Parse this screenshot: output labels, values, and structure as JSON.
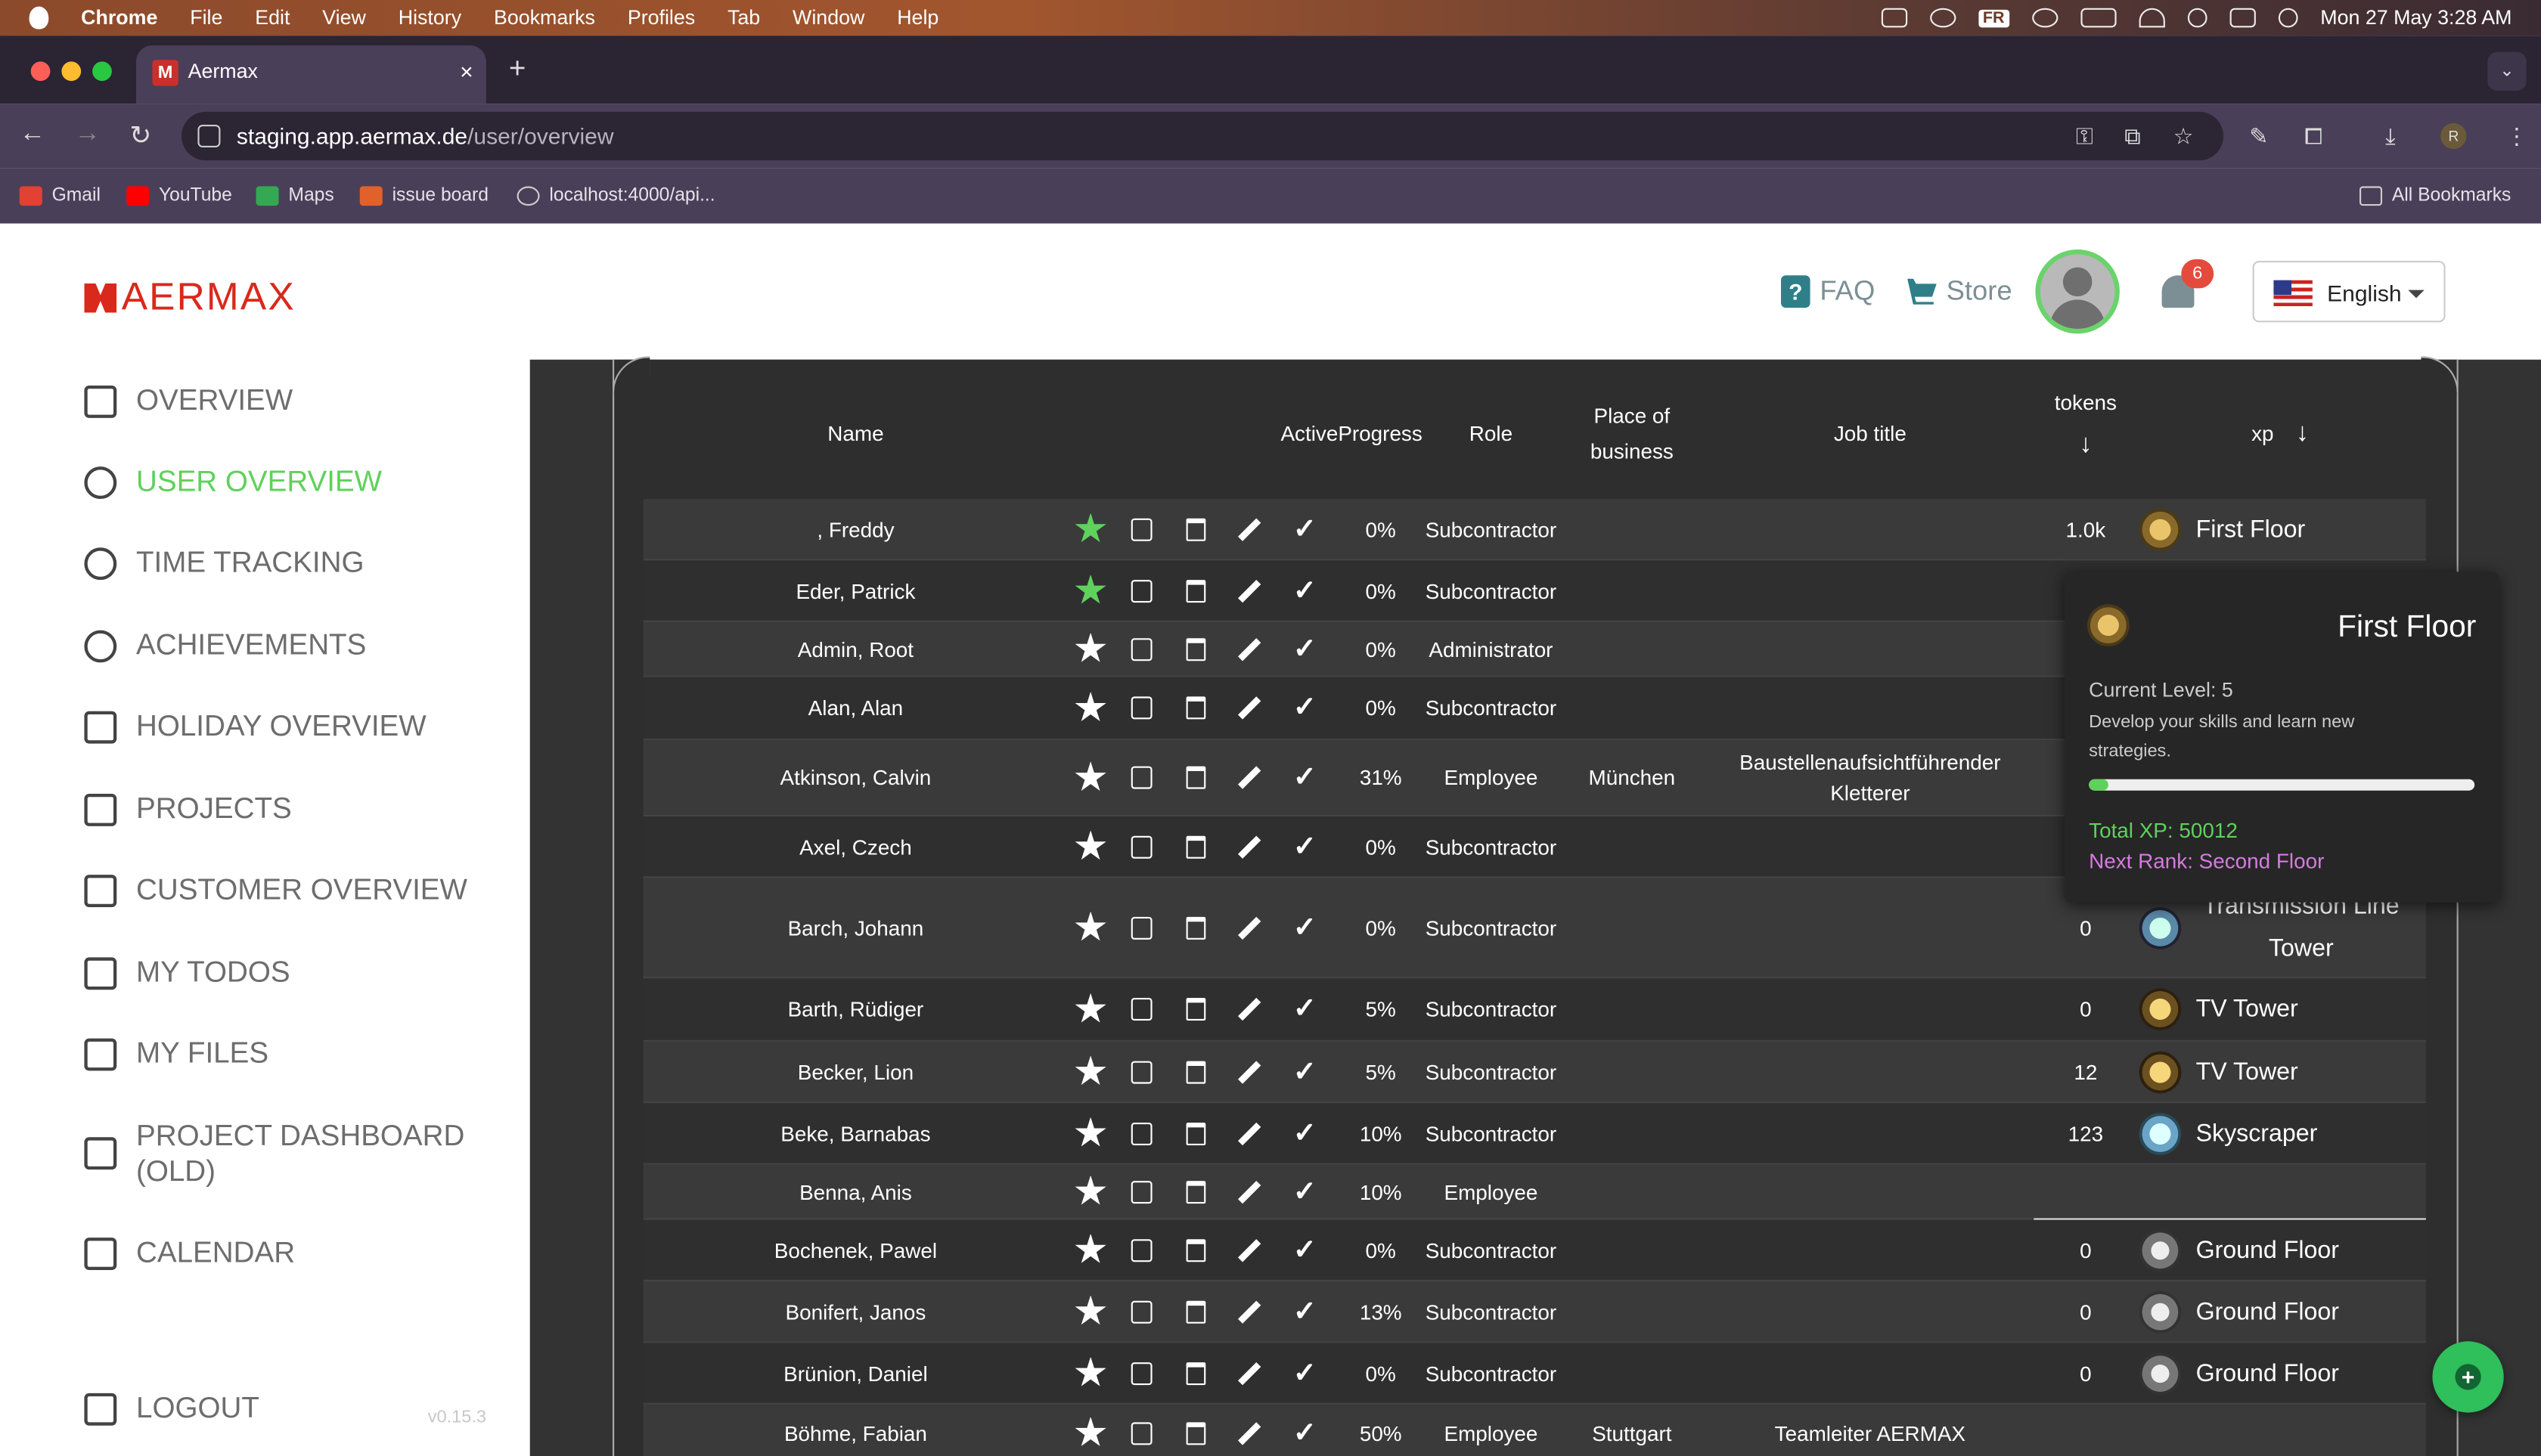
{
  "menubar": {
    "app": "Chrome",
    "items": [
      "File",
      "Edit",
      "View",
      "History",
      "Bookmarks",
      "Profiles",
      "Tab",
      "Window",
      "Help"
    ],
    "status_fr": "FR",
    "datetime": "Mon 27 May  3:28 AM"
  },
  "browser": {
    "tab_title": "Aermax",
    "tab_close": "×",
    "new_tab": "+",
    "url_host": "staging.app.aermax.de",
    "url_path": "/user/overview",
    "profile_initial": "R",
    "bookmarks": [
      "Gmail",
      "YouTube",
      "Maps",
      "issue board",
      "localhost:4000/api..."
    ],
    "all_bookmarks": "All Bookmarks"
  },
  "header": {
    "logo": "AERMAX",
    "faq": "FAQ",
    "store": "Store",
    "notifications": "6",
    "language": "English"
  },
  "sidebar": {
    "items": [
      {
        "label": "OVERVIEW",
        "icon": "dashboard-icon"
      },
      {
        "label": "USER OVERVIEW",
        "icon": "person-icon",
        "active": true
      },
      {
        "label": "TIME TRACKING",
        "icon": "stopwatch-icon"
      },
      {
        "label": "ACHIEVEMENTS",
        "icon": "award-icon"
      },
      {
        "label": "HOLIDAY OVERVIEW",
        "icon": "calendar-icon"
      },
      {
        "label": "PROJECTS",
        "icon": "clipboard-icon"
      },
      {
        "label": "CUSTOMER OVERVIEW",
        "icon": "briefcase-icon"
      },
      {
        "label": "MY TODOS",
        "icon": "checkbox-icon"
      },
      {
        "label": "MY FILES",
        "icon": "folder-icon"
      },
      {
        "label": "PROJECT DASHBOARD (OLD)",
        "icon": "grid-icon"
      },
      {
        "label": "CALENDAR",
        "icon": "calendar-icon"
      }
    ],
    "logout": "LOGOUT",
    "version": "v0.15.3"
  },
  "table": {
    "headers": {
      "name": "Name",
      "active_progress": "ActiveProgress",
      "role": "Role",
      "place1": "Place of",
      "place2": "business",
      "job": "Job title",
      "tokens": "tokens",
      "xp": "xp"
    },
    "rows": [
      {
        "name": ", Freddy",
        "fav": true,
        "progress": "0%",
        "role": "Subcontractor",
        "place": "",
        "job": "",
        "tokens": "1.0k",
        "rank": "First Floor"
      },
      {
        "name": "Eder, Patrick",
        "fav": true,
        "progress": "0%",
        "role": "Subcontractor",
        "place": "",
        "job": "",
        "tokens": "",
        "rank": ""
      },
      {
        "name": "Admin, Root",
        "fav": false,
        "progress": "0%",
        "role": "Administrator",
        "place": "",
        "job": "",
        "tokens": "",
        "rank": ""
      },
      {
        "name": "Alan, Alan",
        "fav": false,
        "progress": "0%",
        "role": "Subcontractor",
        "place": "",
        "job": "",
        "tokens": "",
        "rank": ""
      },
      {
        "name": "Atkinson, Calvin",
        "fav": false,
        "progress": "31%",
        "role": "Employee",
        "place": "München",
        "job": "Baustellenaufsichtführender Kletterer",
        "tokens": "",
        "rank": ""
      },
      {
        "name": "Axel, Czech",
        "fav": false,
        "progress": "0%",
        "role": "Subcontractor",
        "place": "",
        "job": "",
        "tokens": "",
        "rank": ""
      },
      {
        "name": "Barch, Johann",
        "fav": false,
        "progress": "0%",
        "role": "Subcontractor",
        "place": "",
        "job": "",
        "tokens": "0",
        "rank": "Transmission Line Tower"
      },
      {
        "name": "Barth, Rüdiger",
        "fav": false,
        "progress": "5%",
        "role": "Subcontractor",
        "place": "",
        "job": "",
        "tokens": "0",
        "rank": "TV Tower"
      },
      {
        "name": "Becker, Lion",
        "fav": false,
        "progress": "5%",
        "role": "Subcontractor",
        "place": "",
        "job": "",
        "tokens": "12",
        "rank": "TV Tower"
      },
      {
        "name": "Beke, Barnabas",
        "fav": false,
        "progress": "10%",
        "role": "Subcontractor",
        "place": "",
        "job": "",
        "tokens": "123",
        "rank": "Skyscraper"
      },
      {
        "name": "Benna, Anis",
        "fav": false,
        "progress": "10%",
        "role": "Employee",
        "place": "",
        "job": "",
        "tokens": "",
        "rank": ""
      },
      {
        "name": "Bochenek, Pawel",
        "fav": false,
        "progress": "0%",
        "role": "Subcontractor",
        "place": "",
        "job": "",
        "tokens": "0",
        "rank": "Ground Floor"
      },
      {
        "name": "Bonifert, Janos",
        "fav": false,
        "progress": "13%",
        "role": "Subcontractor",
        "place": "",
        "job": "",
        "tokens": "0",
        "rank": "Ground Floor"
      },
      {
        "name": "Brünion, Daniel",
        "fav": false,
        "progress": "0%",
        "role": "Subcontractor",
        "place": "",
        "job": "",
        "tokens": "0",
        "rank": "Ground Floor"
      },
      {
        "name": "Böhme, Fabian",
        "fav": false,
        "progress": "50%",
        "role": "Employee",
        "place": "Stuttgart",
        "job": "Teamleiter AERMAX",
        "tokens": "",
        "rank": ""
      }
    ]
  },
  "tooltip": {
    "title": "First Floor",
    "level": "Current Level: 5",
    "desc": "Develop your skills and learn new strategies.",
    "progress": 0.05,
    "total_xp": "Total XP: 50012",
    "next_rank": "Next Rank: Second Floor"
  },
  "fab": {
    "label": "+"
  },
  "colors": {
    "accent_green": "#5fd15c",
    "brand_red": "#d9291c",
    "next_rank_purple": "#d57be0"
  }
}
